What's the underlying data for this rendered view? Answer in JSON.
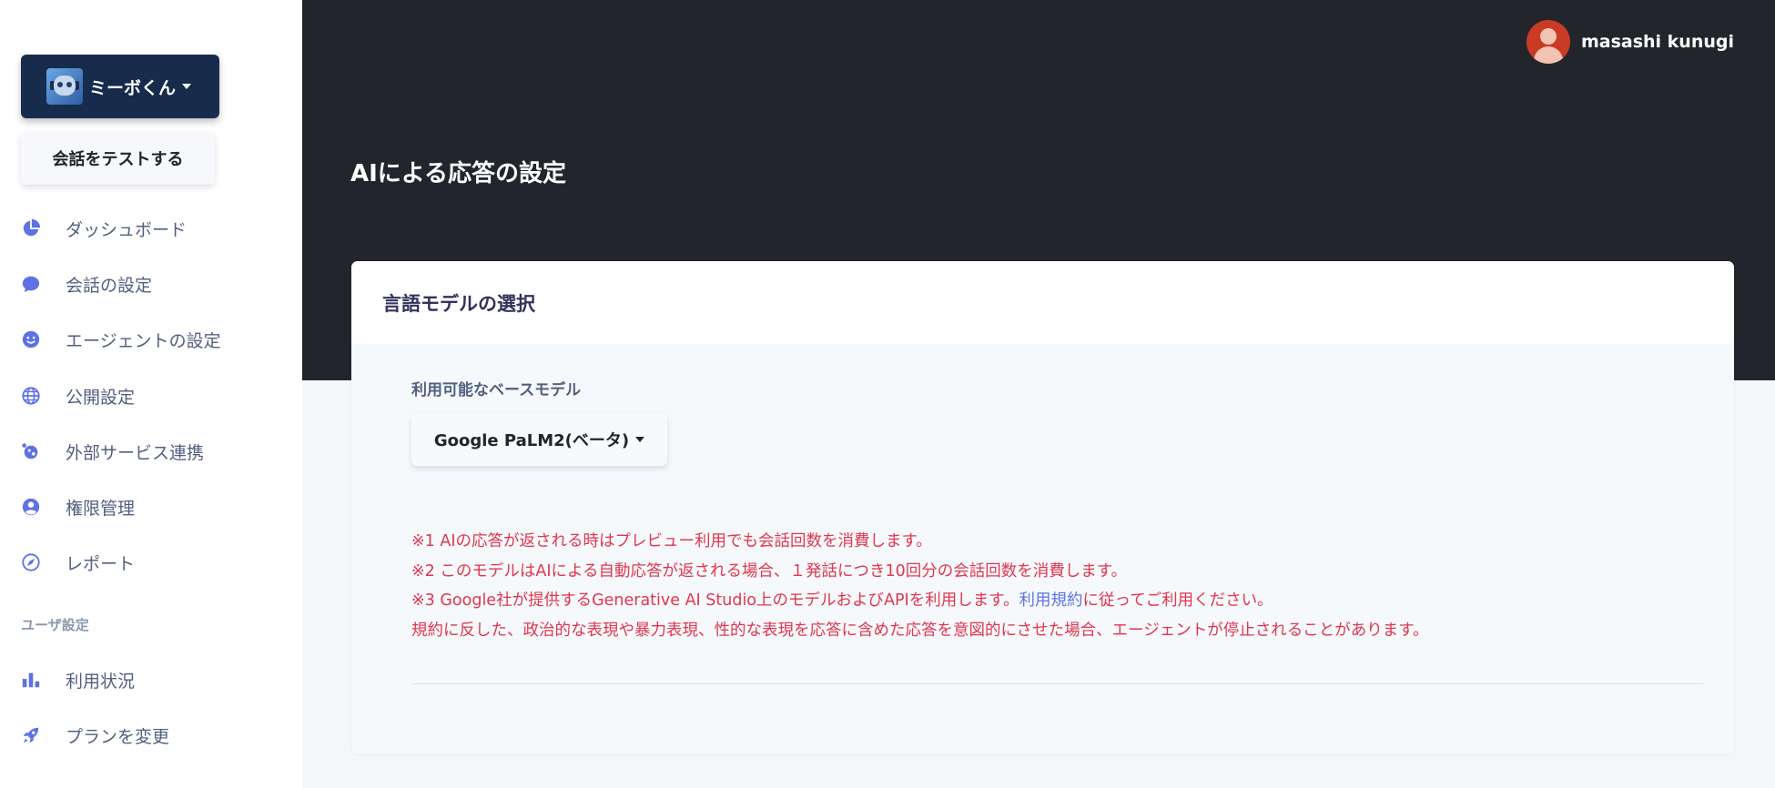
{
  "sidebar": {
    "bot_name": "ミーボくん",
    "test_button": "会話をテストする",
    "items": [
      {
        "label": "ダッシュボード",
        "icon": "pie-chart-icon"
      },
      {
        "label": "会話の設定",
        "icon": "chat-bubble-icon"
      },
      {
        "label": "エージェントの設定",
        "icon": "smiley-icon"
      },
      {
        "label": "公開設定",
        "icon": "globe-icon"
      },
      {
        "label": "外部サービス連携",
        "icon": "planet-icon"
      },
      {
        "label": "権限管理",
        "icon": "user-circle-icon"
      },
      {
        "label": "レポート",
        "icon": "compass-icon"
      }
    ],
    "user_section_heading": "ユーザ設定",
    "user_items": [
      {
        "label": "利用状況",
        "icon": "bar-chart-icon"
      },
      {
        "label": "プランを変更",
        "icon": "rocket-icon"
      }
    ]
  },
  "header": {
    "user_name": "masashi kunugi",
    "page_title": "AIによる応答の設定"
  },
  "card": {
    "title": "言語モデルの選択",
    "field_label": "利用可能なベースモデル",
    "selected_model": "Google PaLM2(ベータ)",
    "notes": {
      "line1": "※1 AIの応答が返される時はプレビュー利用でも会話回数を消費します。",
      "line2": "※2 このモデルはAIによる自動応答が返される場合、１発話につき10回分の会話回数を消費します。",
      "line3_before": "※3 Google社が提供するGenerative AI Studio上のモデルおよびAPIを利用します。",
      "line3_link": "利用規約",
      "line3_after": "に従ってご利用ください。",
      "line4": "規約に反した、政治的な表現や暴力表現、性的な表現を応答に含めた応答を意図的にさせた場合、エージェントが停止されることがあります。"
    }
  },
  "colors": {
    "header_bg": "#23252d",
    "accent": "#5e72e4",
    "warning_text": "#e0364f",
    "bot_button_bg": "#172b4d"
  }
}
